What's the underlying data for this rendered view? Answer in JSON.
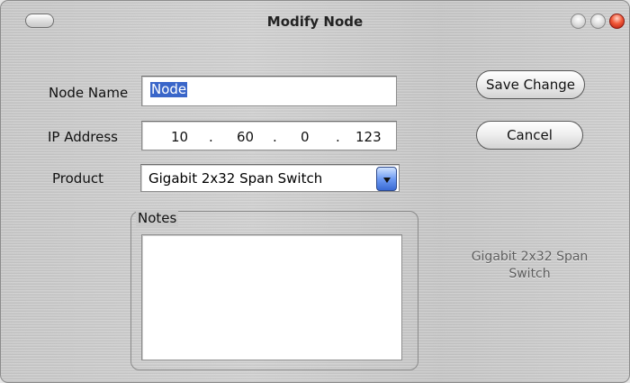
{
  "window": {
    "title": "Modify Node"
  },
  "form": {
    "node_name_label": "Node Name",
    "node_name_value": "Node",
    "ip_label": "IP Address",
    "ip": [
      "10",
      "60",
      "0",
      "123"
    ],
    "ip_sep": ".",
    "product_label": "Product",
    "product_value": "Gigabit 2x32 Span Switch",
    "notes_label": "Notes",
    "notes_value": ""
  },
  "buttons": {
    "save": "Save Change",
    "cancel": "Cancel"
  },
  "info": {
    "product_line1": "Gigabit 2x32 Span",
    "product_line2": "Switch"
  },
  "colors": {
    "selection": "#3a66c9",
    "close": "#e0402a",
    "dropdown_arrow": "#4d7fe3"
  },
  "icons": {
    "window_pill": "toolbar-toggle-icon",
    "minimize": "minimize-icon",
    "zoom": "zoom-icon",
    "close": "close-icon",
    "dropdown": "chevron-down-icon"
  }
}
